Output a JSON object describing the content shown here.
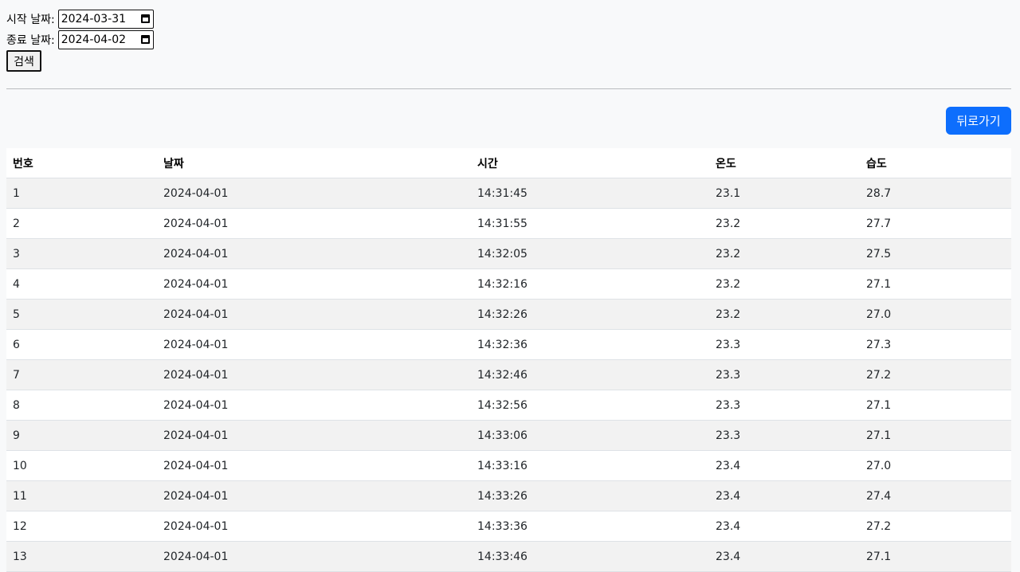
{
  "filters": {
    "start_label": "시작 날짜:",
    "start_value": "2024-03-31",
    "end_label": "종료 날짜:",
    "end_value": "2024-04-02",
    "search_label": "검색"
  },
  "back_button": "뒤로가기",
  "colors": {
    "primary": "#0d6efd",
    "page_bg": "#f8f9fa",
    "stripe": "#f2f2f2"
  },
  "table": {
    "headers": [
      "번호",
      "날짜",
      "시간",
      "온도",
      "습도"
    ],
    "rows": [
      [
        "1",
        "2024-04-01",
        "14:31:45",
        "23.1",
        "28.7"
      ],
      [
        "2",
        "2024-04-01",
        "14:31:55",
        "23.2",
        "27.7"
      ],
      [
        "3",
        "2024-04-01",
        "14:32:05",
        "23.2",
        "27.5"
      ],
      [
        "4",
        "2024-04-01",
        "14:32:16",
        "23.2",
        "27.1"
      ],
      [
        "5",
        "2024-04-01",
        "14:32:26",
        "23.2",
        "27.0"
      ],
      [
        "6",
        "2024-04-01",
        "14:32:36",
        "23.3",
        "27.3"
      ],
      [
        "7",
        "2024-04-01",
        "14:32:46",
        "23.3",
        "27.2"
      ],
      [
        "8",
        "2024-04-01",
        "14:32:56",
        "23.3",
        "27.1"
      ],
      [
        "9",
        "2024-04-01",
        "14:33:06",
        "23.3",
        "27.1"
      ],
      [
        "10",
        "2024-04-01",
        "14:33:16",
        "23.4",
        "27.0"
      ],
      [
        "11",
        "2024-04-01",
        "14:33:26",
        "23.4",
        "27.4"
      ],
      [
        "12",
        "2024-04-01",
        "14:33:36",
        "23.4",
        "27.2"
      ],
      [
        "13",
        "2024-04-01",
        "14:33:46",
        "23.4",
        "27.1"
      ]
    ]
  }
}
